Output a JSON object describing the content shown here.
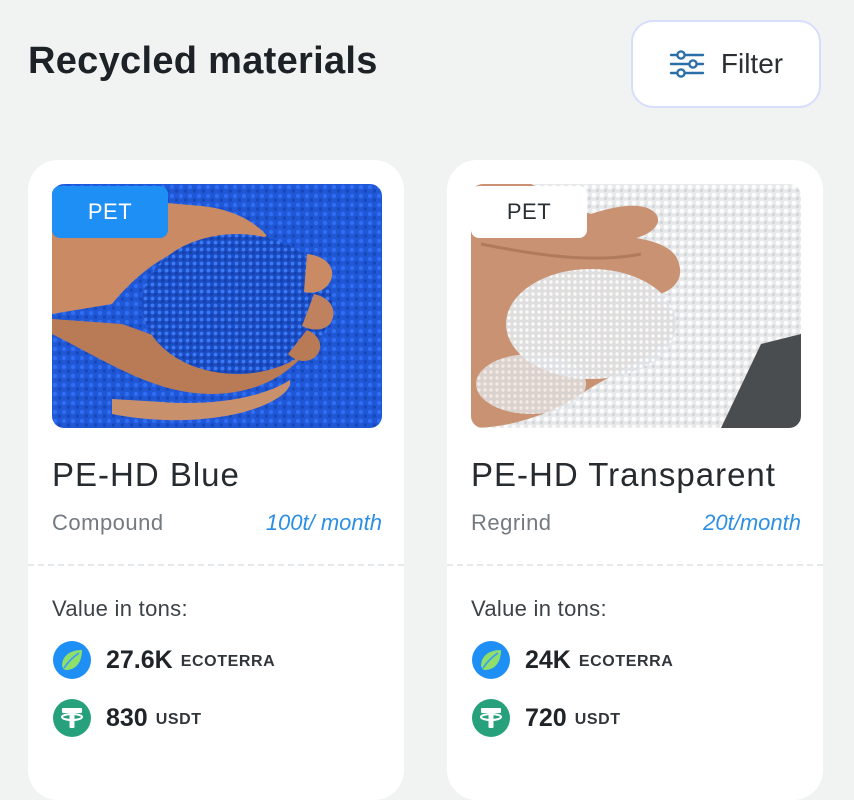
{
  "header": {
    "title": "Recycled materials",
    "filter_label": "Filter"
  },
  "cards": [
    {
      "tag": "PET",
      "title": "PE-HD Blue",
      "type": "Compound",
      "rate": "100t/ month",
      "value_label": "Value in tons:",
      "prices": [
        {
          "amount": "27.6K",
          "currency": "ECOTERRA",
          "icon": "ecoterra-leaf-icon"
        },
        {
          "amount": "830",
          "currency": "USDT",
          "icon": "usdt-tether-icon"
        }
      ],
      "image": "blue plastic pellets in hands"
    },
    {
      "tag": "PET",
      "title": "PE-HD Transparent",
      "type": "Regrind",
      "rate": "20t/month",
      "value_label": "Value in tons:",
      "prices": [
        {
          "amount": "24K",
          "currency": "ECOTERRA",
          "icon": "ecoterra-leaf-icon"
        },
        {
          "amount": "720",
          "currency": "USDT",
          "icon": "usdt-tether-icon"
        }
      ],
      "image": "transparent plastic pellets in hand"
    }
  ],
  "colors": {
    "background": "#f1f3f3",
    "accent_blue": "#1e8ff4",
    "rate_blue": "#2d8fe4",
    "usdt_green": "#26a17b",
    "ecoterra_green": "#7ed957"
  }
}
